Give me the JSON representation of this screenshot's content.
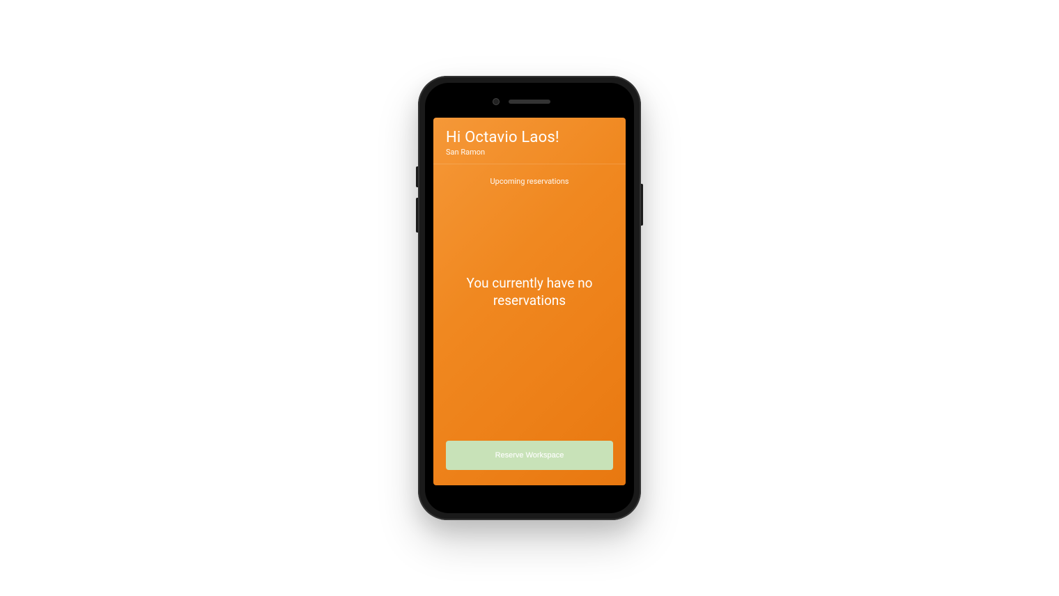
{
  "header": {
    "greeting": "Hi Octavio Laos!",
    "location": "San Ramon"
  },
  "main": {
    "section_title": "Upcoming reservations",
    "empty_message": "You currently have no reservations"
  },
  "actions": {
    "reserve_label": "Reserve Workspace"
  }
}
